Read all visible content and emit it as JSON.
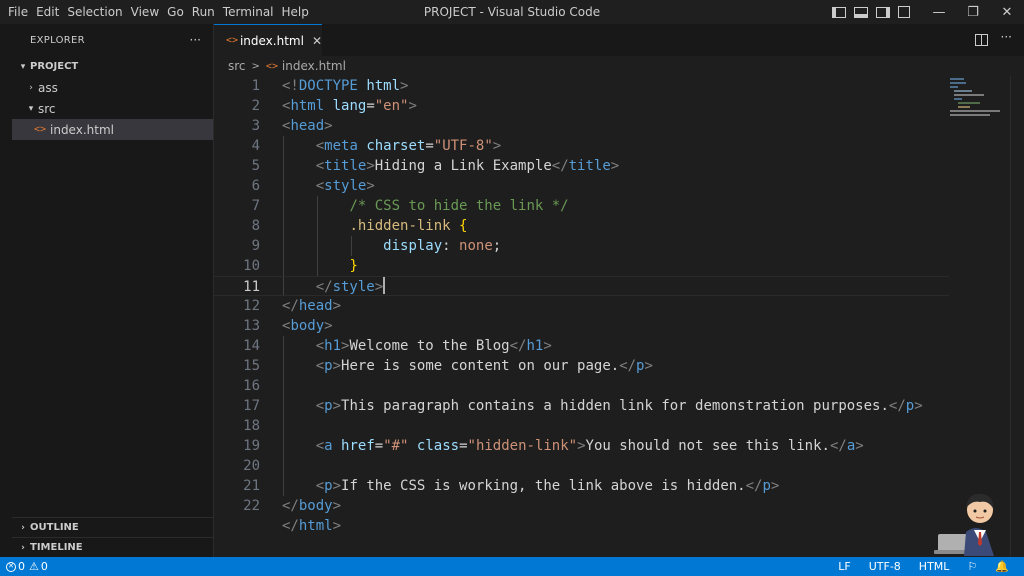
{
  "menu": [
    "File",
    "Edit",
    "Selection",
    "View",
    "Go",
    "Run",
    "Terminal",
    "Help"
  ],
  "window_title": "PROJECT - Visual Studio Code",
  "window_controls": {
    "minimize": "—",
    "restore": "❐",
    "close": "✕"
  },
  "sidebar": {
    "title": "EXPLORER",
    "more": "···",
    "project": "PROJECT",
    "tree": [
      {
        "label": "ass",
        "type": "folder",
        "expanded": false
      },
      {
        "label": "src",
        "type": "folder",
        "expanded": true
      },
      {
        "label": "index.html",
        "type": "file",
        "selected": true
      }
    ],
    "outline": "OUTLINE",
    "timeline": "TIMELINE"
  },
  "tabs": [
    {
      "label": "index.html",
      "icon": "<>",
      "active": true
    }
  ],
  "breadcrumb": {
    "folder": "src",
    "file": "index.html",
    "sep": ">"
  },
  "editor": {
    "line_numbers": [
      "1",
      "2",
      "3",
      "4",
      "5",
      "6",
      "7",
      "8",
      "9",
      "10",
      "11",
      "12",
      "13",
      "14",
      "15",
      "16",
      "17",
      "18",
      "19",
      "20",
      "21",
      "22"
    ],
    "active_line": 10,
    "lines": [
      "<!DOCTYPE html>",
      "<html lang=\"en\">",
      "<head>",
      "    <meta charset=\"UTF-8\">",
      "    <title>Hiding a Link Example</title>",
      "    <style>",
      "        /* CSS to hide the link */",
      "        .hidden-link {",
      "            display: none;",
      "        }",
      "    </style>",
      "</head>",
      "<body>",
      "    <h1>Welcome to the Blog</h1>",
      "    <p>Here is some content on our page.</p>",
      "",
      "    <p>This paragraph contains a hidden link for demonstration purposes.</p>",
      "",
      "    <a href=\"#\" class=\"hidden-link\">You should not see this link.</a>",
      "",
      "    <p>If the CSS is working, the link above is hidden.</p>",
      "</body>",
      "</html>"
    ]
  },
  "statusbar": {
    "errors": "0",
    "warnings": "0",
    "eol": "LF",
    "encoding": "UTF-8",
    "language": "HTML"
  },
  "colors": {
    "accent": "#0078d4",
    "editor_bg": "#1e1e1e",
    "sidebar_bg": "#181818",
    "tag": "#569cd6",
    "attribute": "#9cdcfe",
    "string": "#ce9178",
    "comment": "#6a9955",
    "selector": "#d7ba7d",
    "bracket": "#ffd700"
  }
}
